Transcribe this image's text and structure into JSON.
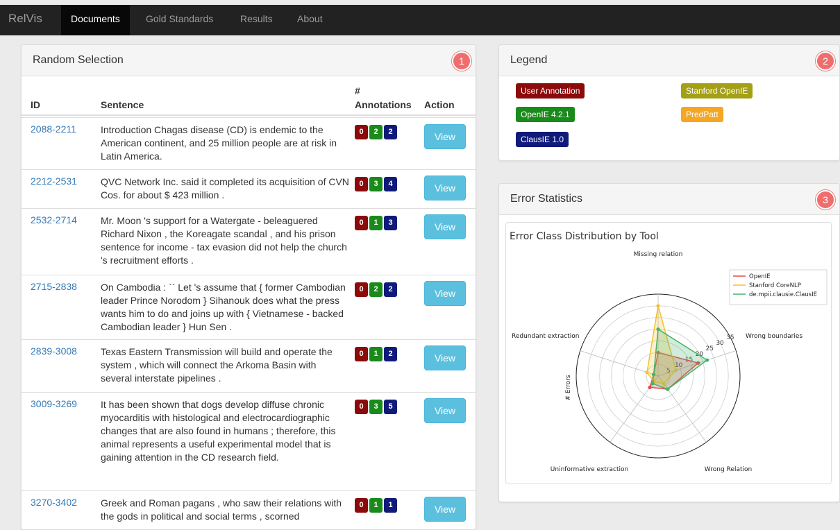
{
  "nav": {
    "brand": "RelVis",
    "items": [
      "Documents",
      "Gold Standards",
      "Results",
      "About"
    ]
  },
  "random_selection": {
    "title": "Random Selection",
    "step": "1",
    "headers": {
      "id": "ID",
      "sentence": "Sentence",
      "annotations_hash": "#",
      "annotations": "Annotations",
      "action": "Action"
    },
    "button_label": "View",
    "rows": [
      {
        "id": "2088-2211",
        "sentence": "Introduction Chagas disease (CD) is endemic to the American continent, and 25 million people are at risk in Latin America.",
        "counts": [
          "0",
          "2",
          "2"
        ]
      },
      {
        "id": "2212-2531",
        "sentence": "QVC Network Inc. said it completed its acquisition of CVN Cos. for about $ 423 million .",
        "counts": [
          "0",
          "3",
          "4"
        ]
      },
      {
        "id": "2532-2714",
        "sentence": "Mr. Moon 's support for a Watergate - beleaguered Richard Nixon , the Koreagate scandal , and his prison sentence for income - tax evasion did not help the church 's recruitment efforts .",
        "counts": [
          "0",
          "1",
          "3"
        ]
      },
      {
        "id": "2715-2838",
        "sentence": "On Cambodia : `` Let 's assume that { former Cambodian leader Prince Norodom } Sihanouk does what the press wants him to do and joins up with { Vietnamese - backed Cambodian leader } Hun Sen .",
        "counts": [
          "0",
          "2",
          "2"
        ]
      },
      {
        "id": "2839-3008",
        "sentence": "Texas Eastern Transmission will build and operate the system , which will connect the Arkoma Basin with several interstate pipelines .",
        "counts": [
          "0",
          "1",
          "2"
        ]
      },
      {
        "id": "3009-3269",
        "sentence": "It has been shown that dogs develop diffuse chronic myocarditis with histological and electrocardiographic changes that are also found in humans ; therefore, this animal represents a useful experimental model that is gaining attention in the CD research field.",
        "counts": [
          "0",
          "3",
          "5"
        ]
      },
      {
        "id": "3270-3402",
        "sentence": "Greek and Roman pagans , who saw their relations with the gods in political and social terms , scorned",
        "counts": [
          "0",
          "1",
          "1"
        ]
      }
    ]
  },
  "legend": {
    "title": "Legend",
    "step": "2",
    "items": [
      {
        "label": "User Annotation",
        "color": "#8b0a0a"
      },
      {
        "label": "Stanford OpenIE",
        "color": "#a4a015"
      },
      {
        "label": "OpenIE 4.2.1",
        "color": "#1a8a1a"
      },
      {
        "label": "PredPatt",
        "color": "#f5a623"
      },
      {
        "label": "ClausIE 1.0",
        "color": "#101a7a"
      }
    ]
  },
  "error_statistics": {
    "title": "Error Statistics",
    "step": "3"
  },
  "chart_data": {
    "type": "radar",
    "title": "Error Class Distribution by Tool",
    "ylabel": "# Errors",
    "categories": [
      "Missing relation",
      "Wrong boundaries",
      "Wrong Relation",
      "Uninformative extraction",
      "Redundant extraction"
    ],
    "radial_ticks": [
      "5",
      "10",
      "15",
      "20",
      "25",
      "30",
      "35"
    ],
    "rmax": 35,
    "series": [
      {
        "name": "OpenIE",
        "color": "#e8474a",
        "values": [
          10,
          18,
          7,
          6,
          2
        ]
      },
      {
        "name": "Stanford CoreNLP",
        "color": "#f2c12e",
        "values": [
          30,
          8,
          4,
          3,
          5
        ]
      },
      {
        "name": "de.mpii.clausie.ClausIE",
        "color": "#46b36a",
        "values": [
          20,
          22,
          7,
          4,
          2
        ]
      }
    ]
  }
}
